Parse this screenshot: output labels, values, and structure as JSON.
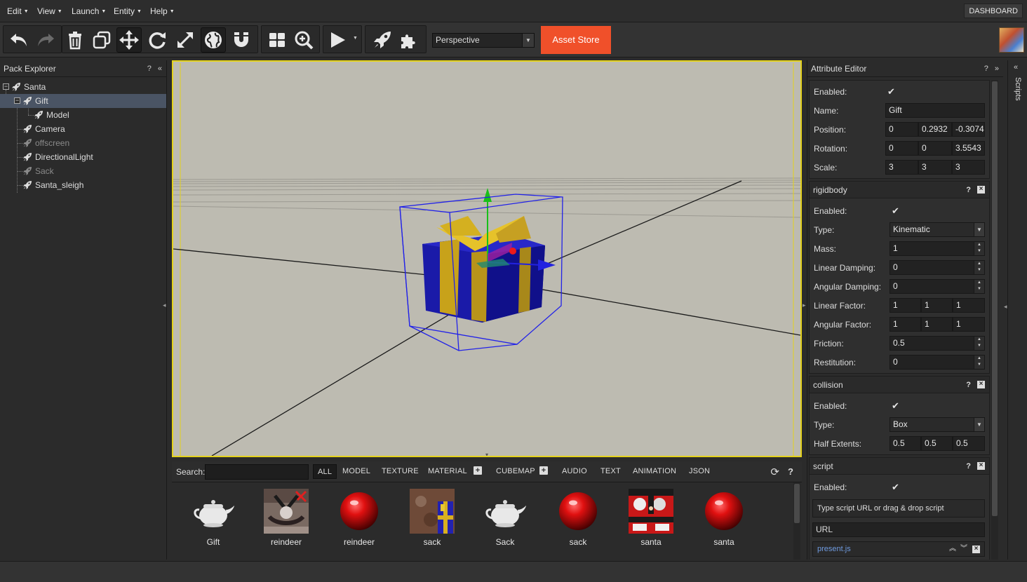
{
  "menu": [
    {
      "label": "Edit"
    },
    {
      "label": "View"
    },
    {
      "label": "Launch"
    },
    {
      "label": "Entity"
    },
    {
      "label": "Help"
    }
  ],
  "dashboard_label": "DASHBOARD",
  "toolbar": {
    "camera_mode": "Perspective",
    "asset_store_label": "Asset Store",
    "icons": [
      "undo-icon",
      "redo-icon",
      "trash-icon",
      "duplicate-icon",
      "translate-icon",
      "rotate-icon",
      "scale-icon",
      "world-space-icon",
      "snap-magnet-icon",
      "grid-icon",
      "zoom-fit-icon",
      "play-icon",
      "launch-icon",
      "plugin-icon"
    ]
  },
  "pack_explorer": {
    "title": "Pack Explorer",
    "items": [
      {
        "label": "Santa",
        "depth": 0,
        "expanded": true,
        "selected": false,
        "disabled": false
      },
      {
        "label": "Gift",
        "depth": 1,
        "expanded": true,
        "selected": true,
        "disabled": false
      },
      {
        "label": "Model",
        "depth": 2,
        "selected": false,
        "disabled": false
      },
      {
        "label": "Camera",
        "depth": 1,
        "selected": false,
        "disabled": false
      },
      {
        "label": "offscreen",
        "depth": 1,
        "selected": false,
        "disabled": true
      },
      {
        "label": "DirectionalLight",
        "depth": 1,
        "selected": false,
        "disabled": false
      },
      {
        "label": "Sack",
        "depth": 1,
        "selected": false,
        "disabled": true
      },
      {
        "label": "Santa_sleigh",
        "depth": 1,
        "selected": false,
        "disabled": false
      }
    ]
  },
  "asset_browser": {
    "search_label": "Search:",
    "search_value": "",
    "filters": [
      "ALL",
      "MODEL",
      "TEXTURE",
      "MATERIAL",
      "CUBEMAP",
      "AUDIO",
      "TEXT",
      "ANIMATION",
      "JSON"
    ],
    "active_filter": "ALL",
    "assets": [
      {
        "name": "Gift",
        "kind": "model"
      },
      {
        "name": "reindeer",
        "kind": "texture"
      },
      {
        "name": "reindeer",
        "kind": "material"
      },
      {
        "name": "sack",
        "kind": "texture"
      },
      {
        "name": "Sack",
        "kind": "model"
      },
      {
        "name": "sack",
        "kind": "material"
      },
      {
        "name": "santa",
        "kind": "texture"
      },
      {
        "name": "santa",
        "kind": "material"
      }
    ]
  },
  "attribute_editor": {
    "title": "Attribute Editor",
    "entity": {
      "enabled_label": "Enabled:",
      "name_label": "Name:",
      "name": "Gift",
      "position_label": "Position:",
      "position": [
        "0",
        "0.2932",
        "-0.3074"
      ],
      "rotation_label": "Rotation:",
      "rotation": [
        "0",
        "0",
        "3.5543"
      ],
      "scale_label": "Scale:",
      "scale": [
        "3",
        "3",
        "3"
      ]
    },
    "rigidbody": {
      "title": "rigidbody",
      "enabled_label": "Enabled:",
      "type_label": "Type:",
      "type": "Kinematic",
      "mass_label": "Mass:",
      "mass": "1",
      "linear_damping_label": "Linear Damping:",
      "linear_damping": "0",
      "angular_damping_label": "Angular Damping:",
      "angular_damping": "0",
      "linear_factor_label": "Linear Factor:",
      "linear_factor": [
        "1",
        "1",
        "1"
      ],
      "angular_factor_label": "Angular Factor:",
      "angular_factor": [
        "1",
        "1",
        "1"
      ],
      "friction_label": "Friction:",
      "friction": "0.5",
      "restitution_label": "Restitution:",
      "restitution": "0"
    },
    "collision": {
      "title": "collision",
      "enabled_label": "Enabled:",
      "type_label": "Type:",
      "type": "Box",
      "half_extents_label": "Half Extents:",
      "half_extents": [
        "0.5",
        "0.5",
        "0.5"
      ]
    },
    "script": {
      "title": "script",
      "enabled_label": "Enabled:",
      "drop_hint": "Type script URL or drag & drop script",
      "url_placeholder": "URL",
      "scripts": [
        "present.js"
      ]
    }
  },
  "scripts_panel_label": "Scripts",
  "colors": {
    "accent": "#f0502a",
    "viewport_bg": "#bdbbb1",
    "selection_outline": "#e4d21c",
    "script_link": "#6f9be0"
  }
}
